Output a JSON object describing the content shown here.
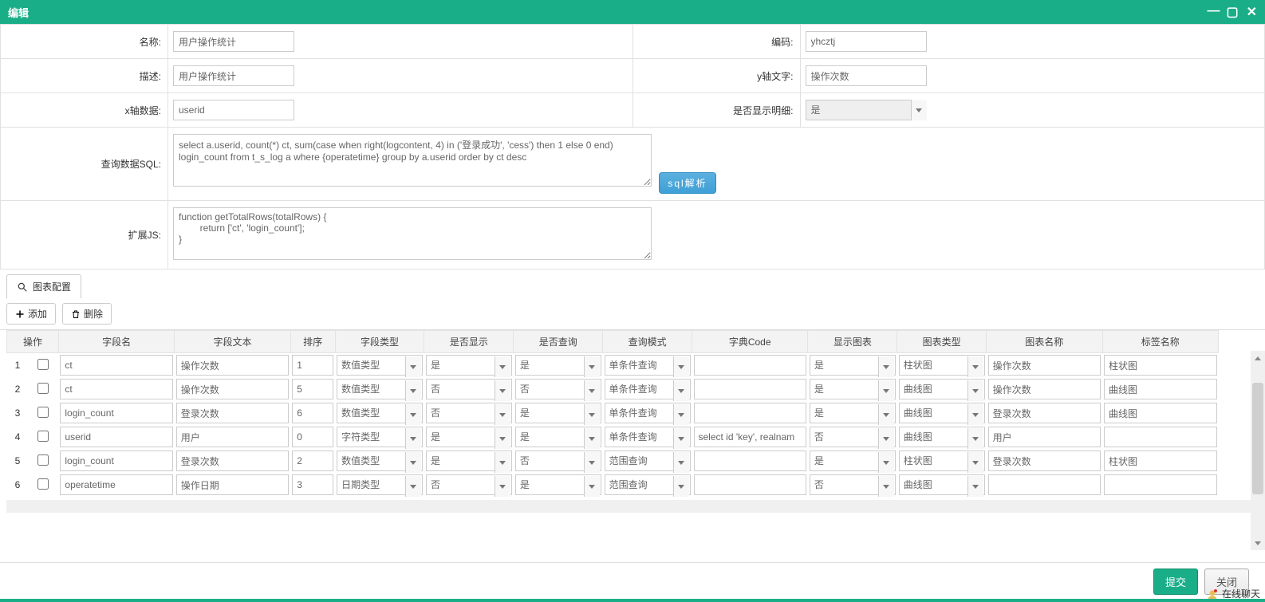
{
  "window": {
    "title": "编辑"
  },
  "form": {
    "labels": {
      "name": "名称:",
      "code": "编码:",
      "desc": "描述:",
      "ytext": "y轴文字:",
      "xdata": "x轴数据:",
      "showdetail": "是否显示明细:",
      "sql": "查询数据SQL:",
      "ext": "扩展JS:"
    },
    "values": {
      "name": "用户操作统计",
      "code": "yhcztj",
      "desc": "用户操作统计",
      "ytext": "操作次数",
      "xdata": "userid",
      "showdetail": "是",
      "sql": "select a.userid, count(*) ct, sum(case when right(logcontent, 4) in ('登录成功', 'cess') then 1 else 0 end) login_count from t_s_log a where {operatetime} group by a.userid order by ct desc",
      "ext": "function getTotalRows(totalRows) {\n        return ['ct', 'login_count'];\n}"
    },
    "sqlParseBtn": "sql解析"
  },
  "tabs": {
    "chartConfig": "图表配置"
  },
  "toolbar": {
    "add": "添加",
    "delete": "删除"
  },
  "grid": {
    "headers": {
      "op": "操作",
      "fieldName": "字段名",
      "fieldText": "字段文本",
      "order": "排序",
      "fieldType": "字段类型",
      "isShow": "是否显示",
      "isQuery": "是否查询",
      "queryMode": "查询模式",
      "dictCode": "字典Code",
      "showChart": "显示图表",
      "chartType": "图表类型",
      "chartName": "图表名称",
      "labelName": "标签名称"
    },
    "rows": [
      {
        "n": "1",
        "fieldName": "ct",
        "fieldText": "操作次数",
        "order": "1",
        "fieldType": "数值类型",
        "isShow": "是",
        "isQuery": "是",
        "queryMode": "单条件查询",
        "dictCode": "",
        "showChart": "是",
        "chartType": "柱状图",
        "chartName": "操作次数",
        "labelName": "柱状图"
      },
      {
        "n": "2",
        "fieldName": "ct",
        "fieldText": "操作次数",
        "order": "5",
        "fieldType": "数值类型",
        "isShow": "否",
        "isQuery": "否",
        "queryMode": "单条件查询",
        "dictCode": "",
        "showChart": "是",
        "chartType": "曲线图",
        "chartName": "操作次数",
        "labelName": "曲线图"
      },
      {
        "n": "3",
        "fieldName": "login_count",
        "fieldText": "登录次数",
        "order": "6",
        "fieldType": "数值类型",
        "isShow": "否",
        "isQuery": "是",
        "queryMode": "单条件查询",
        "dictCode": "",
        "showChart": "是",
        "chartType": "曲线图",
        "chartName": "登录次数",
        "labelName": "曲线图"
      },
      {
        "n": "4",
        "fieldName": "userid",
        "fieldText": "用户",
        "order": "0",
        "fieldType": "字符类型",
        "isShow": "是",
        "isQuery": "是",
        "queryMode": "单条件查询",
        "dictCode": "select id 'key', realnam",
        "showChart": "否",
        "chartType": "曲线图",
        "chartName": "用户",
        "labelName": ""
      },
      {
        "n": "5",
        "fieldName": "login_count",
        "fieldText": "登录次数",
        "order": "2",
        "fieldType": "数值类型",
        "isShow": "是",
        "isQuery": "否",
        "queryMode": "范围查询",
        "dictCode": "",
        "showChart": "是",
        "chartType": "柱状图",
        "chartName": "登录次数",
        "labelName": "柱状图"
      },
      {
        "n": "6",
        "fieldName": "operatetime",
        "fieldText": "操作日期",
        "order": "3",
        "fieldType": "日期类型",
        "isShow": "否",
        "isQuery": "是",
        "queryMode": "范围查询",
        "dictCode": "",
        "showChart": "否",
        "chartType": "曲线图",
        "chartName": "",
        "labelName": ""
      }
    ]
  },
  "footer": {
    "submit": "提交",
    "close": "关闭"
  },
  "chat": {
    "label": "在线聊天"
  }
}
